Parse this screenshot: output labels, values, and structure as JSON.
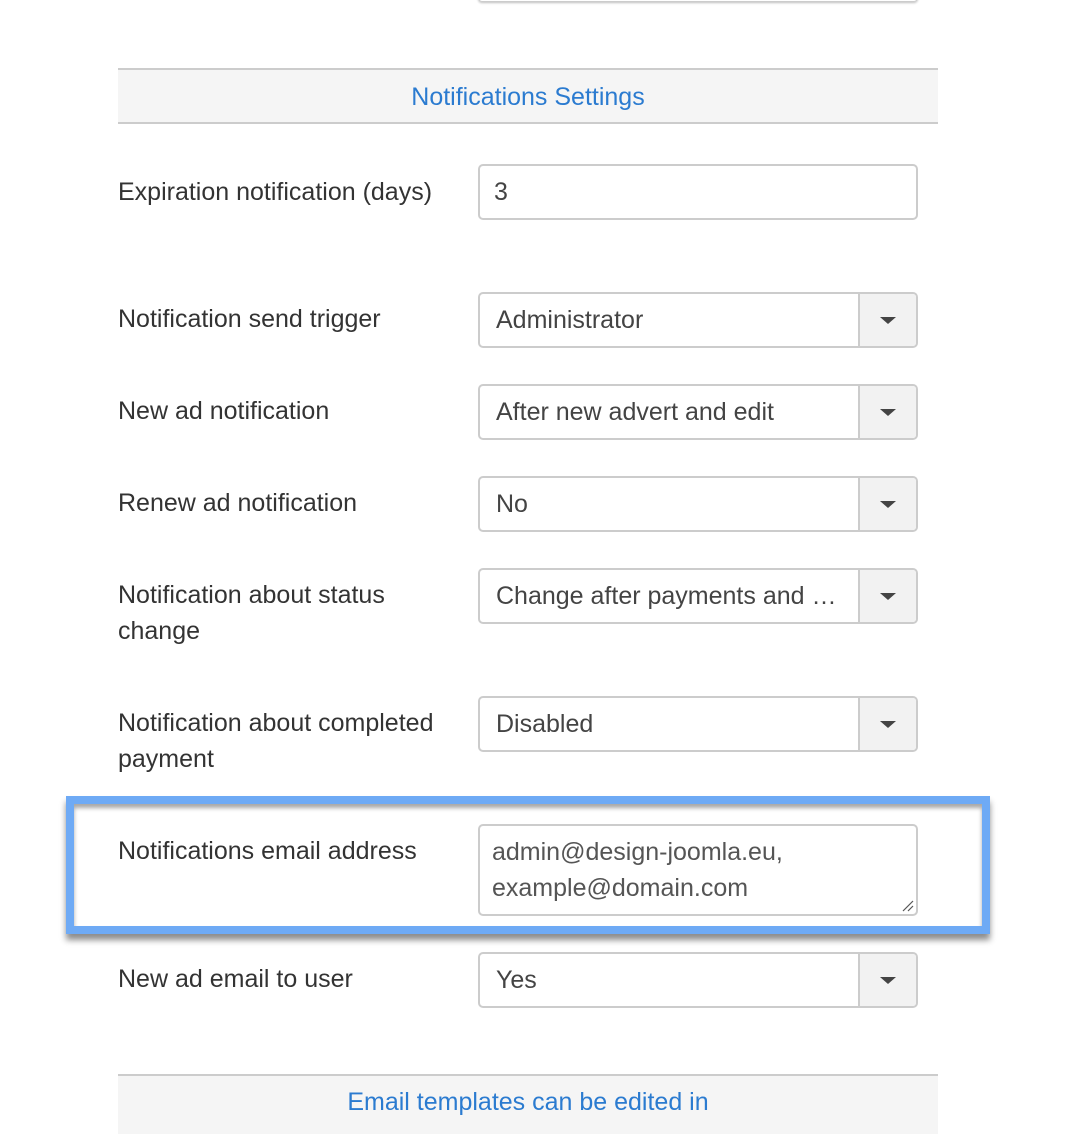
{
  "section_title": "Notifications Settings",
  "fields": {
    "expiration": {
      "label": "Expiration notification (days)",
      "value": "3"
    },
    "send_trigger": {
      "label": "Notification send trigger",
      "value": "Administrator"
    },
    "new_ad": {
      "label": "New ad notification",
      "value": "After new advert and edit"
    },
    "renew_ad": {
      "label": "Renew ad notification",
      "value": "No"
    },
    "status_change": {
      "label": "Notification about status change",
      "value": "Change after payments and …"
    },
    "completed_payment": {
      "label": "Notification about completed payment",
      "value": "Disabled"
    },
    "email_address": {
      "label": "Notifications email address",
      "value_line1": "admin@design-joomla.eu,",
      "value_line2": "example@domain.com"
    },
    "new_ad_email_user": {
      "label": "New ad email to user",
      "value": "Yes"
    }
  },
  "footer_link": "Email templates can be edited in",
  "colors": {
    "accent": "#2b7bd0",
    "highlight": "#6eaaf5"
  }
}
